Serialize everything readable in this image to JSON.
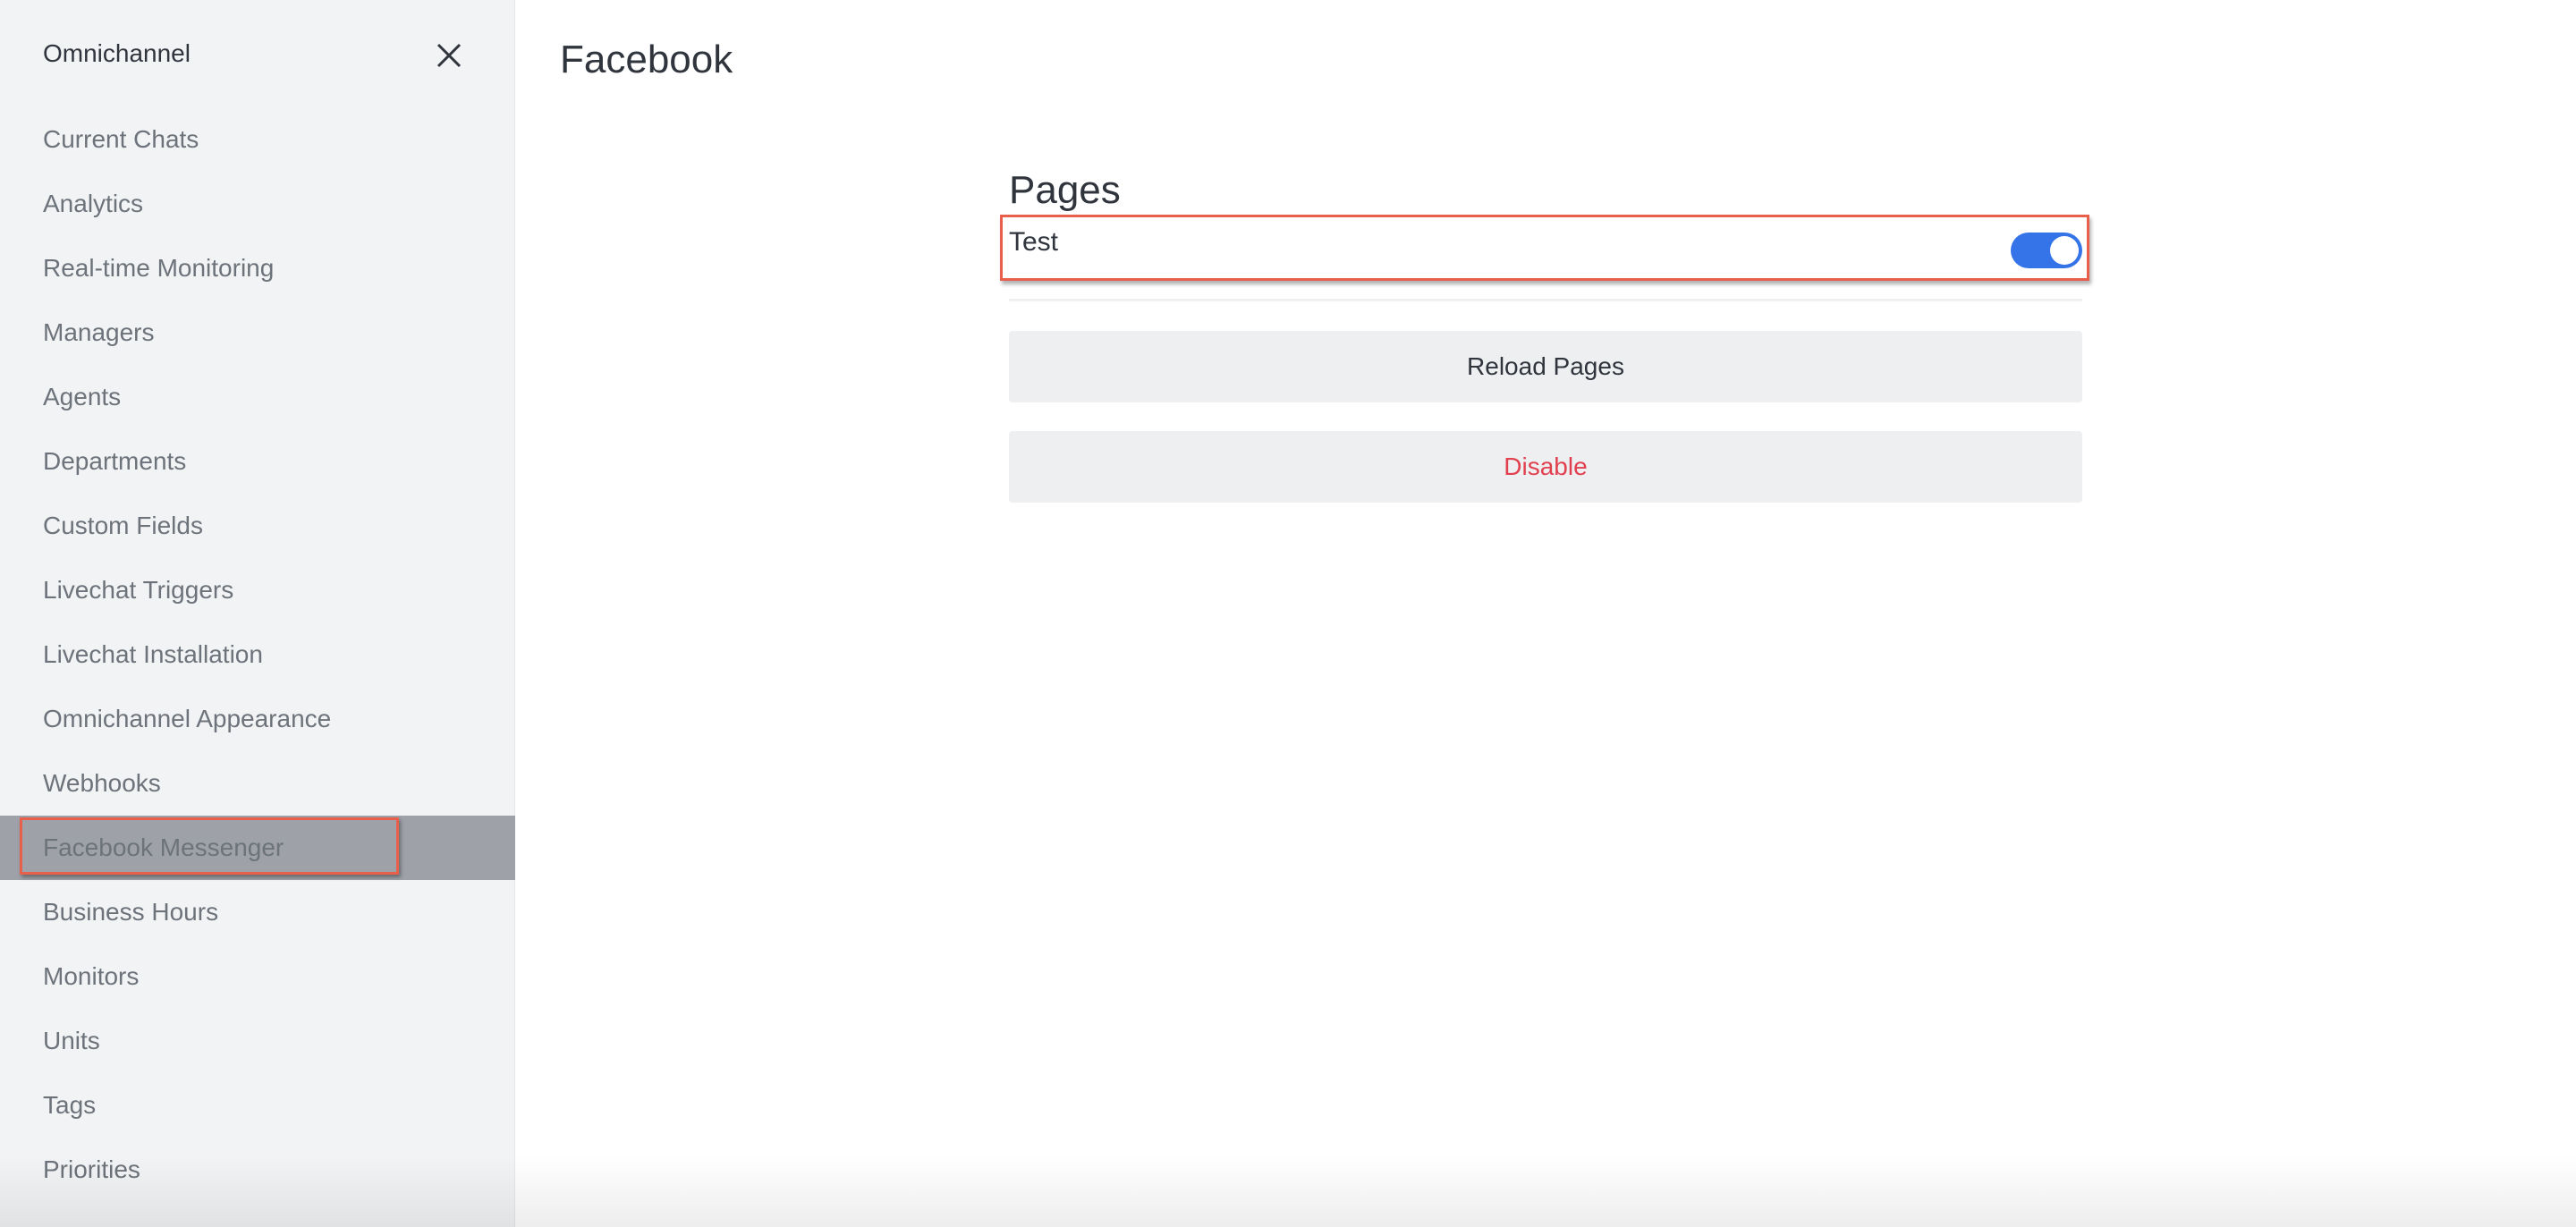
{
  "sidebar": {
    "title": "Omnichannel",
    "close_icon": "close-icon",
    "items": [
      {
        "label": "Current Chats"
      },
      {
        "label": "Analytics"
      },
      {
        "label": "Real-time Monitoring"
      },
      {
        "label": "Managers"
      },
      {
        "label": "Agents"
      },
      {
        "label": "Departments"
      },
      {
        "label": "Custom Fields"
      },
      {
        "label": "Livechat Triggers"
      },
      {
        "label": "Livechat Installation"
      },
      {
        "label": "Omnichannel Appearance"
      },
      {
        "label": "Webhooks"
      },
      {
        "label": "Facebook Messenger",
        "selected": true
      },
      {
        "label": "Business Hours"
      },
      {
        "label": "Monitors"
      },
      {
        "label": "Units"
      },
      {
        "label": "Tags"
      },
      {
        "label": "Priorities"
      }
    ]
  },
  "main": {
    "title": "Facebook",
    "section_title": "Pages",
    "pages": [
      {
        "name": "Test",
        "enabled": true
      }
    ],
    "buttons": {
      "reload": "Reload Pages",
      "disable": "Disable"
    }
  },
  "colors": {
    "accent": "#3574e8",
    "danger": "#e1414f",
    "highlight_box": "#e8604c",
    "selected_row": "#9ea2a8"
  }
}
